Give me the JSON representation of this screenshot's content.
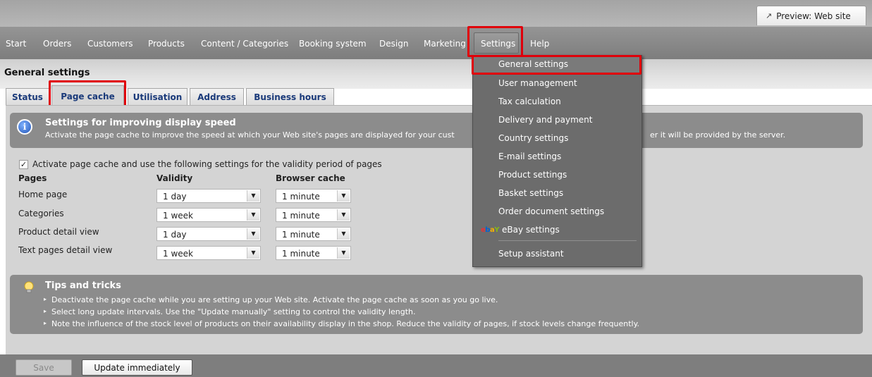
{
  "top": {
    "preview_label": "Preview: Web site",
    "preview_icon": "external-link-icon"
  },
  "nav": {
    "items": [
      "Start",
      "Orders",
      "Customers",
      "Products",
      "Content / Categories",
      "Booking system",
      "Design",
      "Marketing",
      "Settings",
      "Help"
    ]
  },
  "page": {
    "title": "General settings",
    "tabs": [
      "Status",
      "Page cache",
      "Utilisation",
      "Address",
      "Business hours"
    ],
    "active_tab": "Page cache"
  },
  "info": {
    "icon": "info-icon",
    "title": "Settings for improving display speed",
    "description": "Activate the page cache to improve the speed at which your Web site's pages are displayed for your cust",
    "description_tail": "er it will be provided by the server."
  },
  "cache": {
    "checkbox_checked": true,
    "checkbox_label": "Activate page cache and use the following settings for the validity period of pages",
    "headers": {
      "pages": "Pages",
      "validity": "Validity",
      "browser_cache": "Browser cache"
    },
    "rows": [
      {
        "label": "Home page",
        "validity": "1 day",
        "browser": "1 minute"
      },
      {
        "label": "Categories",
        "validity": "1 week",
        "browser": "1 minute"
      },
      {
        "label": "Product detail view",
        "validity": "1 day",
        "browser": "1 minute"
      },
      {
        "label": "Text pages detail view",
        "validity": "1 week",
        "browser": "1 minute"
      }
    ]
  },
  "tips": {
    "icon": "lightbulb-icon",
    "title": "Tips and tricks",
    "items": [
      "Deactivate the page cache while you are setting up your Web site. Activate the page cache as soon as you go live.",
      "Select long update intervals. Use the \"Update manually\" setting to control the validity length.",
      "Note the influence of the stock level of products on their availability display in the shop. Reduce the validity of pages, if stock levels change frequently."
    ]
  },
  "buttons": {
    "save": "Save",
    "update": "Update immediately"
  },
  "settings_menu": {
    "items": [
      "General settings",
      "User management",
      "Tax calculation",
      "Delivery and payment",
      "Country settings",
      "E-mail settings",
      "Product settings",
      "Basket settings",
      "Order document settings",
      "eBay settings",
      "Setup assistant"
    ],
    "ebay_logo": {
      "e": "e",
      "b": "b",
      "a": "a",
      "y": "Y"
    }
  },
  "colors": {
    "highlight": "#e0000a",
    "tab_text": "#1a3a7a",
    "menu_bg": "#6c6c6c"
  }
}
